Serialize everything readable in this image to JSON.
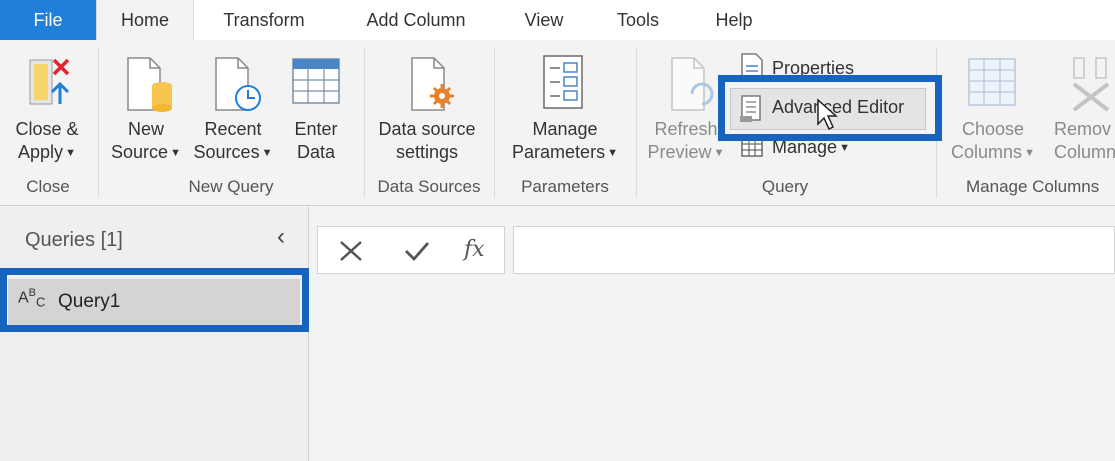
{
  "menu": {
    "tabs": [
      "File",
      "Home",
      "Transform",
      "Add Column",
      "View",
      "Tools",
      "Help"
    ]
  },
  "ribbon": {
    "close_apply": {
      "line1": "Close &",
      "line2": "Apply"
    },
    "new_source": {
      "line1": "New",
      "line2": "Source"
    },
    "recent_sources": {
      "line1": "Recent",
      "line2": "Sources"
    },
    "enter_data": {
      "line1": "Enter",
      "line2": "Data"
    },
    "data_source_settings": {
      "line1": "Data source",
      "line2": "settings"
    },
    "manage_parameters": {
      "line1": "Manage",
      "line2": "Parameters"
    },
    "refresh_preview": {
      "line1": "Refresh",
      "line2": "Preview"
    },
    "properties": "Properties",
    "advanced_editor": "Advanced Editor",
    "manage": "Manage",
    "choose_columns": {
      "line1": "Choose",
      "line2": "Columns"
    },
    "remove_columns": {
      "line1": "Remov",
      "line2": "Column"
    },
    "groups": {
      "close": "Close",
      "new_query": "New Query",
      "data_sources": "Data Sources",
      "parameters": "Parameters",
      "query": "Query",
      "manage_columns": "Manage Columns"
    }
  },
  "queries": {
    "header": "Queries [1]",
    "items": [
      {
        "label": "Query1",
        "type_icon": "abc-text-icon"
      }
    ]
  },
  "formula": {
    "fx": "fx",
    "value": ""
  },
  "colors": {
    "accent": "#1f7fd9",
    "highlight": "#1565c0",
    "close_red": "#e8212e",
    "orange": "#e8822a"
  }
}
